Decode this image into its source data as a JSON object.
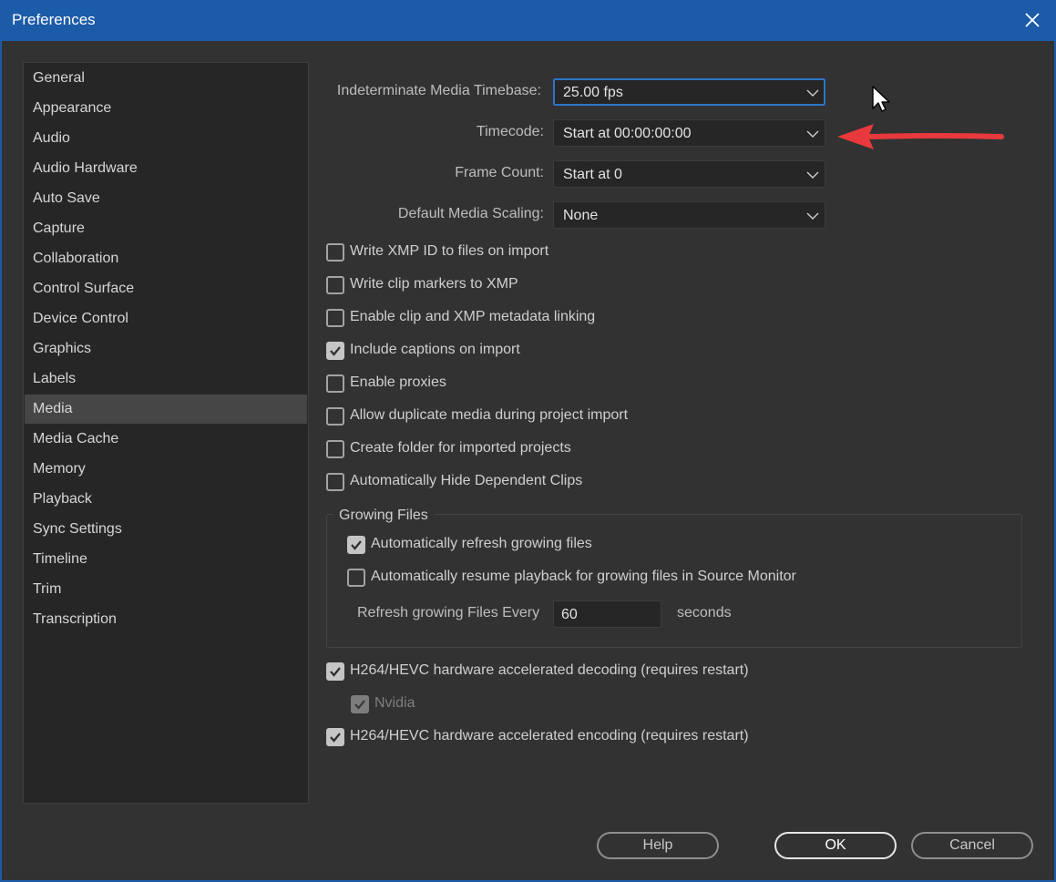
{
  "window": {
    "title": "Preferences",
    "close_icon": "close-icon"
  },
  "sidebar": {
    "items": [
      {
        "label": "General"
      },
      {
        "label": "Appearance"
      },
      {
        "label": "Audio"
      },
      {
        "label": "Audio Hardware"
      },
      {
        "label": "Auto Save"
      },
      {
        "label": "Capture"
      },
      {
        "label": "Collaboration"
      },
      {
        "label": "Control Surface"
      },
      {
        "label": "Device Control"
      },
      {
        "label": "Graphics"
      },
      {
        "label": "Labels"
      },
      {
        "label": "Media"
      },
      {
        "label": "Media Cache"
      },
      {
        "label": "Memory"
      },
      {
        "label": "Playback"
      },
      {
        "label": "Sync Settings"
      },
      {
        "label": "Timeline"
      },
      {
        "label": "Trim"
      },
      {
        "label": "Transcription"
      }
    ],
    "selected": "Media"
  },
  "fields": {
    "timebase": {
      "label": "Indeterminate Media Timebase:",
      "value": "25.00 fps"
    },
    "timecode": {
      "label": "Timecode:",
      "value": "Start at 00:00:00:00"
    },
    "frame_count": {
      "label": "Frame Count:",
      "value": "Start at 0"
    },
    "scaling": {
      "label": "Default Media Scaling:",
      "value": "None"
    }
  },
  "checkboxes": [
    {
      "label": "Write XMP ID to files on import",
      "checked": false
    },
    {
      "label": "Write clip markers to XMP",
      "checked": false
    },
    {
      "label": "Enable clip and XMP metadata linking",
      "checked": false
    },
    {
      "label": "Include captions on import",
      "checked": true
    },
    {
      "label": "Enable proxies",
      "checked": false
    },
    {
      "label": "Allow duplicate media during project import",
      "checked": false
    },
    {
      "label": "Create folder for imported projects",
      "checked": false
    },
    {
      "label": "Automatically Hide Dependent Clips",
      "checked": false
    }
  ],
  "growing_files": {
    "title": "Growing Files",
    "auto_refresh": {
      "label": "Automatically refresh growing files",
      "checked": true
    },
    "auto_resume": {
      "label": "Automatically resume playback for growing files in Source Monitor",
      "checked": false
    },
    "refresh_label": "Refresh growing Files Every",
    "refresh_value": "60",
    "refresh_unit": "seconds"
  },
  "hw": {
    "decoding": {
      "label": "H264/HEVC hardware accelerated decoding (requires restart)",
      "checked": true
    },
    "nvidia": {
      "label": "Nvidia",
      "checked": true,
      "disabled": true
    },
    "encoding": {
      "label": "H264/HEVC hardware accelerated encoding (requires restart)",
      "checked": true
    }
  },
  "buttons": {
    "help": "Help",
    "ok": "OK",
    "cancel": "Cancel"
  },
  "annotation": {
    "arrow_color": "#e8393c"
  }
}
